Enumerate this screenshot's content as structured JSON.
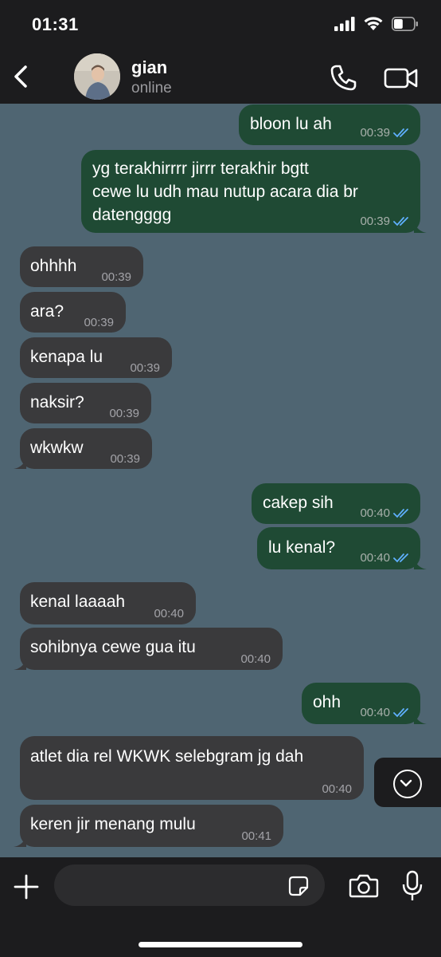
{
  "status_bar": {
    "time": "01:31",
    "battery_level": 0.45
  },
  "header": {
    "back_icon": "chevron-left-icon",
    "name": "gian",
    "status": "online",
    "call_icon": "phone-icon",
    "video_icon": "video-camera-icon"
  },
  "colors": {
    "chat_bg": "#4f6572",
    "outgoing": "#1f4a34",
    "incoming": "#3a3a3c",
    "read_ticks": "#5fb0ff"
  },
  "messages": [
    {
      "direction": "out",
      "text": "bloon lu ah",
      "time": "00:39",
      "status": "read"
    },
    {
      "direction": "out",
      "text": "yg terakhirrrr jirrr terakhir bgtt\ncewe lu udh mau nutup acara dia br\ndatengggg",
      "time": "00:39",
      "status": "read"
    },
    {
      "direction": "in",
      "text": "ohhhh",
      "time": "00:39"
    },
    {
      "direction": "in",
      "text": "ara?",
      "time": "00:39"
    },
    {
      "direction": "in",
      "text": "kenapa lu",
      "time": "00:39"
    },
    {
      "direction": "in",
      "text": "naksir?",
      "time": "00:39"
    },
    {
      "direction": "in",
      "text": "wkwkw",
      "time": "00:39"
    },
    {
      "direction": "out",
      "text": "cakep sih",
      "time": "00:40",
      "status": "read"
    },
    {
      "direction": "out",
      "text": "lu kenal?",
      "time": "00:40",
      "status": "read"
    },
    {
      "direction": "in",
      "text": "kenal laaaah",
      "time": "00:40"
    },
    {
      "direction": "in",
      "text": "sohibnya cewe gua itu",
      "time": "00:40"
    },
    {
      "direction": "out",
      "text": "ohh",
      "time": "00:40",
      "status": "read"
    },
    {
      "direction": "in",
      "text": "atlet dia rel WKWK selebgram jg dah",
      "time": "00:40"
    },
    {
      "direction": "in",
      "text": "keren jir menang mulu",
      "time": "00:41"
    }
  ],
  "composer": {
    "plus_icon": "plus-icon",
    "sticker_icon": "sticker-icon",
    "camera_icon": "camera-icon",
    "mic_icon": "microphone-icon",
    "scroll_icon": "chevron-down-icon"
  }
}
